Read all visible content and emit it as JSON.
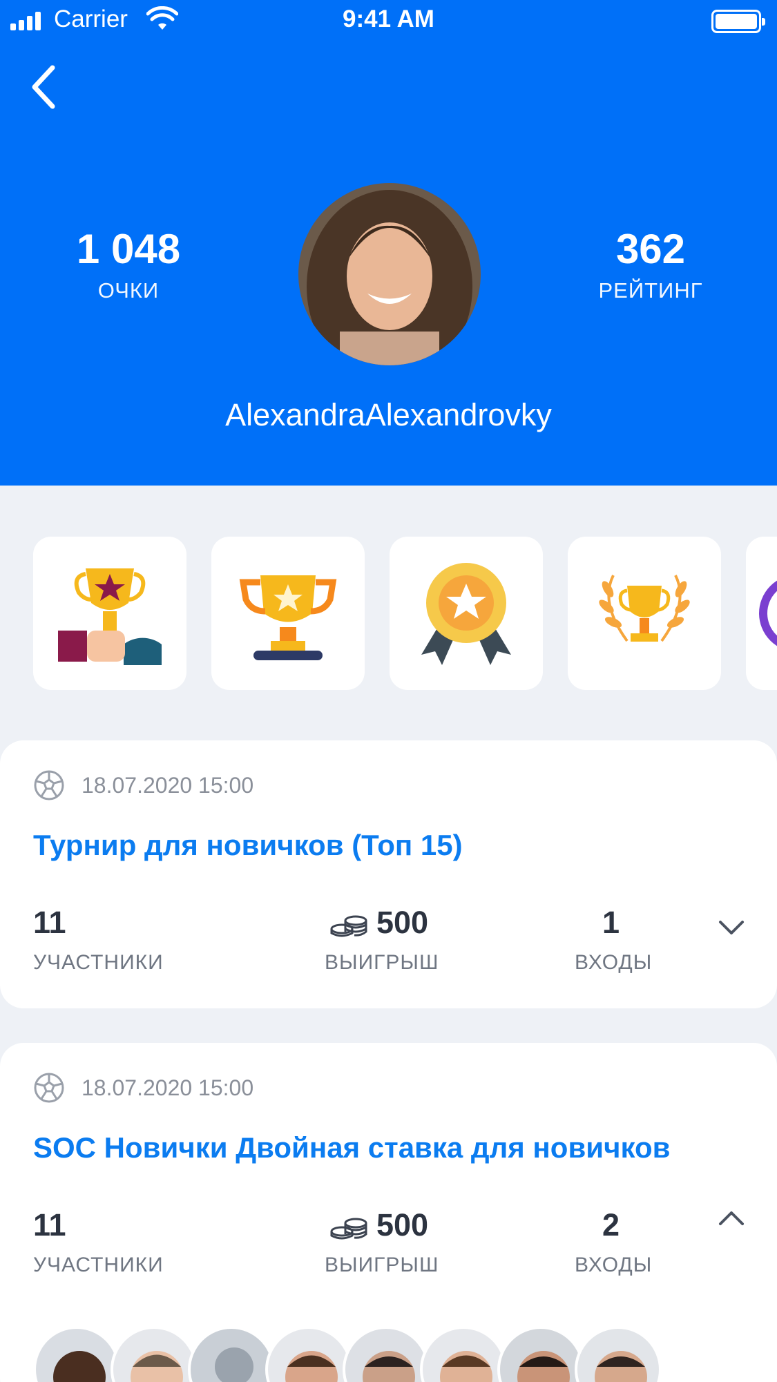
{
  "status_bar": {
    "carrier": "Carrier",
    "time": "9:41 AM"
  },
  "profile": {
    "points": "1 048",
    "points_label": "ОЧКИ",
    "rating": "362",
    "rating_label": "РЕЙТИНГ",
    "username": "AlexandraAlexandrovky"
  },
  "achievements": [
    {
      "icon": "trophy-hand-icon"
    },
    {
      "icon": "trophy-star-icon"
    },
    {
      "icon": "medal-star-icon"
    },
    {
      "icon": "trophy-laurel-icon"
    },
    {
      "icon": "badge-partial-icon"
    }
  ],
  "tournaments": [
    {
      "date": "18.07.2020 15:00",
      "title": "Турнир для новичков (Топ 15)",
      "participants": "11",
      "participants_label": "УЧАСТНИКИ",
      "prize": "500",
      "prize_label": "ВЫИГРЫШ",
      "entries": "1",
      "entries_label": "ВХОДЫ",
      "expanded": false
    },
    {
      "date": "18.07.2020 15:00",
      "title": "SOC Новички Двойная ставка для новичков",
      "participants": "11",
      "participants_label": "УЧАСТНИКИ",
      "prize": "500",
      "prize_label": "ВЫИГРЫШ",
      "entries": "2",
      "entries_label": "ВХОДЫ",
      "expanded": true
    }
  ],
  "colors": {
    "primary": "#0070f8",
    "link": "#0b7cf0",
    "background": "#eef1f6"
  }
}
